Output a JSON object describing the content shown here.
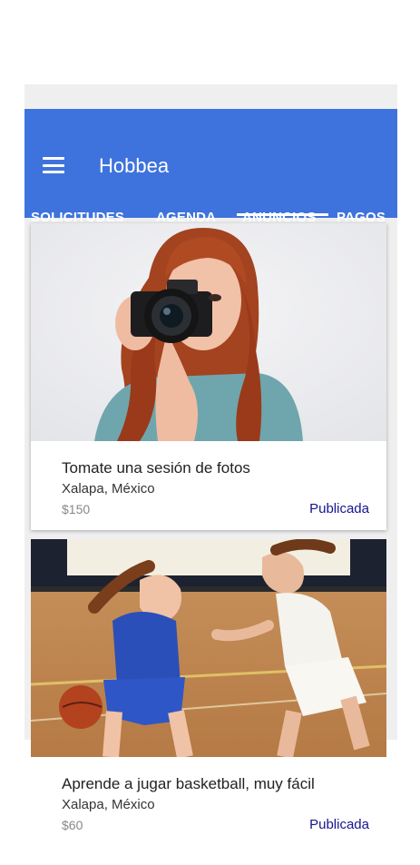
{
  "app": {
    "title": "Hobbea"
  },
  "tabs": [
    {
      "label": "SOLICITUDES"
    },
    {
      "label": "AGENDA"
    },
    {
      "label": "ANUNCIOS"
    },
    {
      "label": "PAGOS"
    }
  ],
  "active_tab": "ANUNCIOS",
  "listings": [
    {
      "image": "photo-woman-with-camera",
      "title": "Tomate una sesión de fotos",
      "location": "Xalapa, México",
      "price": "$150",
      "status": "Publicada"
    },
    {
      "image": "photo-basketball-players",
      "title": "Aprende a jugar basketball, muy fácil",
      "location": "Xalapa, México",
      "price": "$60",
      "status": "Publicada"
    }
  ],
  "colors": {
    "primary": "#3e73dd",
    "status_text": "#14148f",
    "background": "#efefef"
  },
  "icons": {
    "menu": "hamburger-menu-icon"
  }
}
